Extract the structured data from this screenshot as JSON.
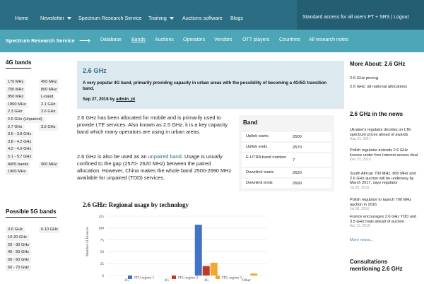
{
  "topnav": {
    "items": [
      {
        "label": "Home",
        "caret": false
      },
      {
        "label": "Newsletter",
        "caret": true
      },
      {
        "label": "Spectrum Research Service",
        "caret": false
      },
      {
        "label": "Training",
        "caret": true
      },
      {
        "label": "Auctions software",
        "caret": false
      },
      {
        "label": "Blogs",
        "caret": false
      }
    ],
    "access": "Standard access for all users PT + SRS | Logout"
  },
  "subnav": {
    "brand": "Spectrum Research Service",
    "arrow": "⟶",
    "items": [
      "Database",
      "Bands",
      "Auctions",
      "Operators",
      "Vendors",
      "OTT players",
      "Countries",
      "All research notes"
    ],
    "active": "Bands"
  },
  "left": {
    "bands_heading": "4G bands",
    "bands": [
      "170 MHz",
      "450 MHz",
      "700 MHz",
      "800 MHz",
      "850 MHz",
      "L-band",
      "1800 MHz",
      "2.1 GHz",
      "2.3 GHz",
      "2.6 GHz",
      "2.6 GHz (Unpaired)",
      "2.7 GHz",
      "3.5 GHz",
      "3.6 - 3.8 GHz",
      "3.8 - 4.2 GHz",
      "4.2 - 4.9 GHz",
      "5.1 - 5.7 GHz",
      "AWS bands",
      "900 MHz",
      "1900 MHz"
    ],
    "fiveg_heading": "Possible 5G bands",
    "fiveg": [
      "3-6 GHz",
      "6-10 GHz",
      "10-20 GHz",
      "20 - 30 GHz",
      "40 - 50 GHz",
      "50 - 60 GHz",
      "60 - 70 GHz"
    ]
  },
  "intro": {
    "title": "2.6 GHz",
    "desc": "A very popular 4G band, primarily providing capacity in urban areas with the possibility of becoming a 4G/5G transition band.",
    "date": "Sep 27, 2016 by ",
    "author": "admin_pt"
  },
  "body": {
    "p1": "2.6 GHz has been allocated for mobile and is primarily used to provide LTE services. Also known as 2.5 GHz, it is a key capacity band which many operators are using in urban areas.",
    "p2a": "2.6 GHz is also be used as an ",
    "p2link": "unpaired band",
    "p2b": ". Usage is usually confined to the gap (2570- 2620 MHz) between the paired allocation. However, China makes the whole band 2500-2690 MHz available for unpaired (TDD) services."
  },
  "band_table": {
    "heading": "Band",
    "rows": [
      {
        "k": "Uplink starts",
        "v": "2500"
      },
      {
        "k": "Uplink ends",
        "v": "2570"
      },
      {
        "k": "E-UTRA band number",
        "v": "7"
      },
      {
        "k": "Downlink starts",
        "v": "2620"
      },
      {
        "k": "Downlink ends",
        "v": "2690"
      }
    ]
  },
  "right": {
    "about_heading": "More About: 2.6 GHz",
    "about_links": [
      "2.6 GHz pricing",
      "2.6 GHz: all national allocations"
    ],
    "news_heading": "2.6 GHz in the news",
    "news": [
      {
        "text": "Ukraine's regulator decides on LTE spectrum prices ahead of awards",
        "date": "Aug 21, 2017"
      },
      {
        "text": "Polish regulator extends 2.6 GHz licence under free Internet access deal",
        "date": "Dec 22, 2016"
      },
      {
        "text": "South African 700 MHz, 800 MHz and 2.6 GHz auction will be underway by March 2017, says regulator",
        "date": "Jul 26, 2016"
      },
      {
        "text": "Polish regulator to launch 700 MHz auction in 2016",
        "date": "Jul 06, 2016"
      },
      {
        "text": "France encourages 2.6 GHz TDD and 3.5 GHz trials ahead of auction",
        "date": "Apr 13, 2016"
      }
    ],
    "more": "More news...",
    "consult_heading": "Consultations mentioning 2.6 GHz"
  },
  "chart_data": {
    "type": "bar",
    "title": "2.6 GHz: Regional usage by technology",
    "ylabel": "Number of licences",
    "xlabel": "",
    "categories": [
      "2G",
      "3G",
      "4G",
      "Other"
    ],
    "ylim": [
      0,
      125
    ],
    "yticks": [
      0,
      25,
      50,
      75,
      100,
      125
    ],
    "series": [
      {
        "name": "ITU region 1",
        "color": "#4472c4",
        "values": [
          0,
          0,
          107,
          0
        ]
      },
      {
        "name": "ITU region 2",
        "color": "#c0392b",
        "values": [
          0,
          0,
          20,
          0
        ]
      },
      {
        "name": "ITU region 3",
        "color": "#f0a830",
        "values": [
          0,
          0,
          27,
          4
        ]
      }
    ],
    "grid": true,
    "legend": "bottom"
  }
}
